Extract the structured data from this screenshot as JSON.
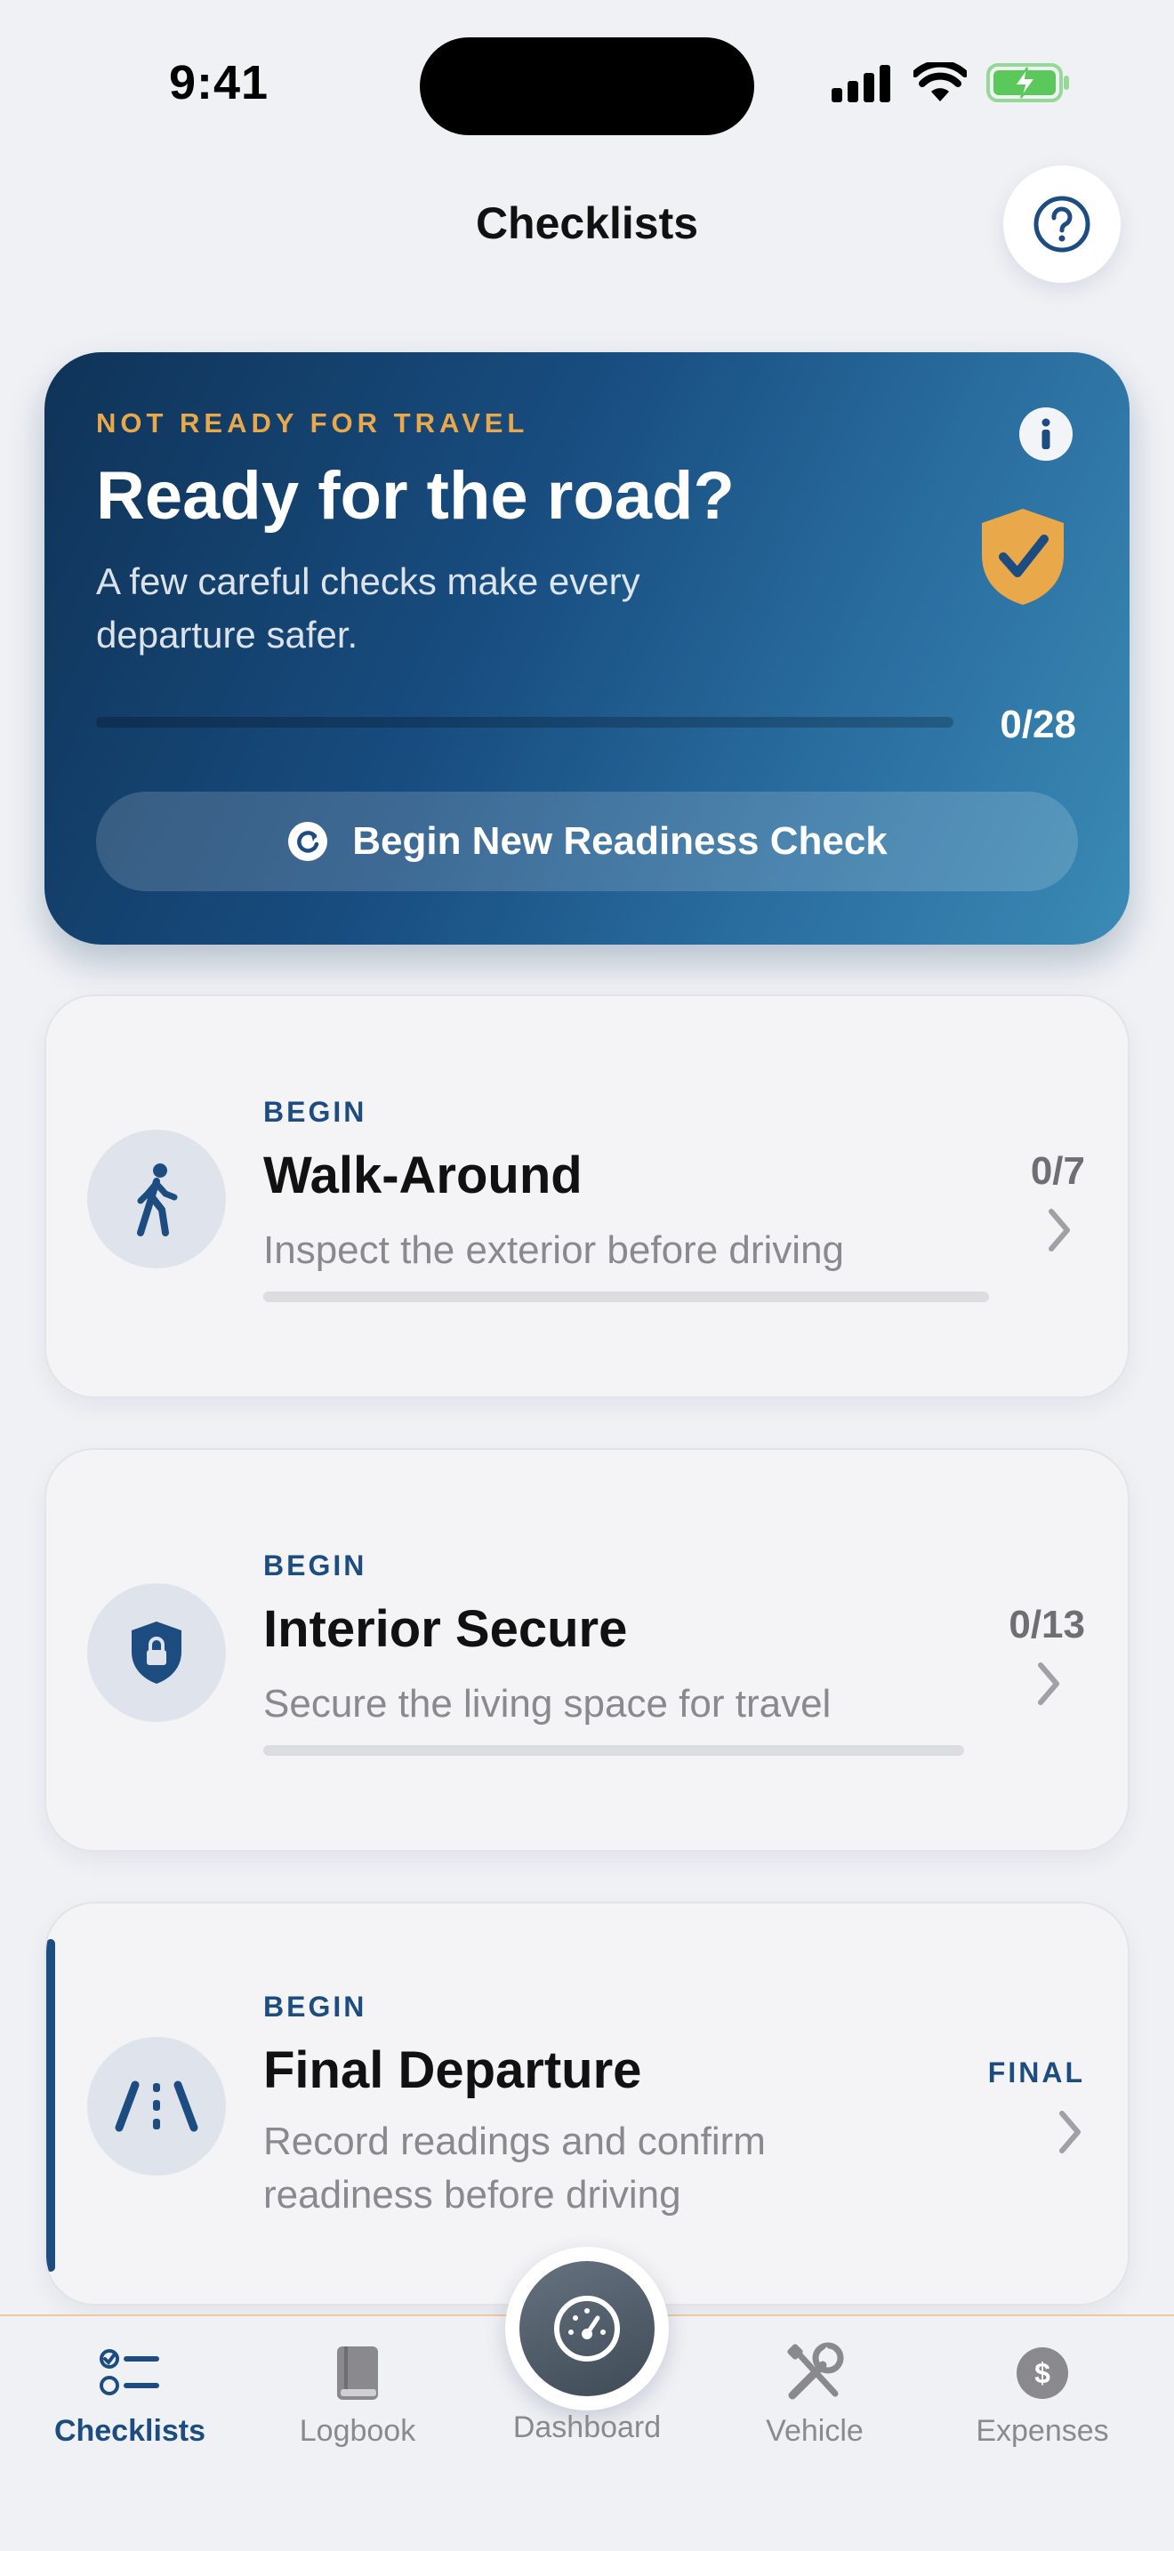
{
  "status_bar": {
    "time": "9:41"
  },
  "nav": {
    "title": "Checklists",
    "help_icon": "question-circle-icon"
  },
  "hero": {
    "kicker": "NOT READY FOR TRAVEL",
    "title": "Ready for the road?",
    "subtitle": "A few careful checks make every departure safer.",
    "progress_text": "0/28",
    "progress_fraction": 0,
    "button_label": "Begin New Readiness Check",
    "accent_color": "#e9a84a"
  },
  "cards": [
    {
      "kicker": "BEGIN",
      "title": "Walk-Around",
      "subtitle": "Inspect the exterior before driving",
      "count": "0/7",
      "icon": "walking-person-icon"
    },
    {
      "kicker": "BEGIN",
      "title": "Interior Secure",
      "subtitle": "Secure the living space for travel",
      "count": "0/13",
      "icon": "lock-shield-icon"
    },
    {
      "kicker": "BEGIN",
      "title": "Final Departure",
      "subtitle": "Record readings and confirm readiness before driving",
      "badge": "FINAL",
      "icon": "road-icon"
    }
  ],
  "tabs": [
    {
      "label": "Checklists",
      "icon": "checklist-icon",
      "active": true
    },
    {
      "label": "Logbook",
      "icon": "book-icon",
      "active": false
    },
    {
      "label": "Dashboard",
      "icon": "gauge-icon",
      "active": false
    },
    {
      "label": "Vehicle",
      "icon": "tools-icon",
      "active": false
    },
    {
      "label": "Expenses",
      "icon": "dollar-icon",
      "active": false
    }
  ],
  "colors": {
    "brand": "#1d4d80",
    "background": "#eff1f5"
  }
}
